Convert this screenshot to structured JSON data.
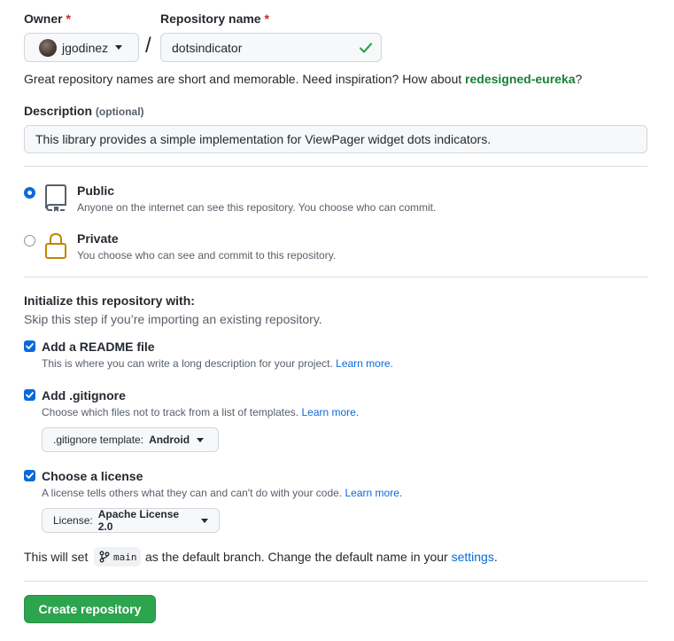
{
  "owner": {
    "label": "Owner",
    "required_mark": "*",
    "value": "jgodinez"
  },
  "separator": "/",
  "repo_name": {
    "label": "Repository name",
    "required_mark": "*",
    "value": "dotsindicator"
  },
  "suggestion": {
    "prefix": "Great repository names are short and memorable. Need inspiration? How about ",
    "name": "redesigned-eureka",
    "suffix": "?"
  },
  "description": {
    "label": "Description",
    "optional": "(optional)",
    "value": "This library provides a simple implementation for ViewPager widget  dots indicators."
  },
  "visibility": {
    "public": {
      "title": "Public",
      "subtitle": "Anyone on the internet can see this repository. You choose who can commit.",
      "selected": true
    },
    "private": {
      "title": "Private",
      "subtitle": "You choose who can see and commit to this repository.",
      "selected": false
    }
  },
  "initialize": {
    "heading": "Initialize this repository with:",
    "note": "Skip this step if you’re importing an existing repository.",
    "readme": {
      "title": "Add a README file",
      "text": "This is where you can write a long description for your project. ",
      "link": "Learn more.",
      "checked": true
    },
    "gitignore": {
      "title": "Add .gitignore",
      "text": "Choose which files not to track from a list of templates. ",
      "link": "Learn more.",
      "checked": true,
      "select_prefix": ".gitignore template: ",
      "select_value": "Android"
    },
    "license": {
      "title": "Choose a license",
      "text": "A license tells others what they can and can't do with your code. ",
      "link": "Learn more.",
      "checked": true,
      "select_prefix": "License: ",
      "select_value": "Apache License 2.0"
    }
  },
  "branch": {
    "prefix": "This will set ",
    "name": "main",
    "middle": " as the default branch. Change the default name in your ",
    "link": "settings",
    "suffix": "."
  },
  "submit": {
    "label": "Create repository"
  },
  "colors": {
    "accent": "#0969da",
    "success": "#2da44e",
    "link_green": "#1a7f37",
    "required": "#cf222e"
  },
  "icons": {
    "public": "repo-icon",
    "private": "lock-icon",
    "branch": "git-branch-icon",
    "valid": "check-icon"
  }
}
